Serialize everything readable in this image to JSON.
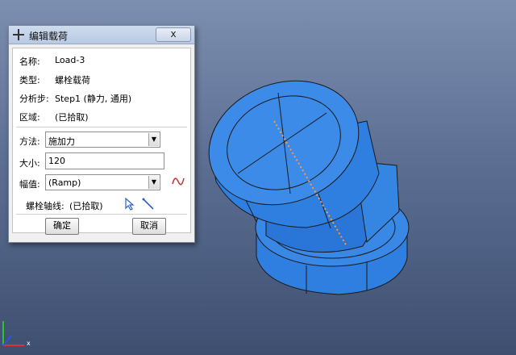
{
  "dialog": {
    "title": "编辑载荷",
    "close_glyph": "x",
    "name_label": "名称:",
    "name_value": "Load-3",
    "type_label": "类型:",
    "type_value": "螺栓载荷",
    "step_label": "分析步:",
    "step_value": "Step1 (静力, 通用)",
    "region_label": "区域:",
    "region_value": "(已拾取)",
    "method_label": "方法:",
    "method_value": "施加力",
    "magnitude_label": "大小:",
    "magnitude_value": "120",
    "amplitude_label": "幅值:",
    "amplitude_value": "(Ramp)",
    "bolt_axis_label": "螺栓轴线:",
    "bolt_axis_value": "(已拾取)",
    "ok_label": "确定",
    "cancel_label": "取消"
  },
  "triad": {
    "x_label": "x"
  },
  "colors": {
    "part_blue": "#2f7fe0",
    "part_blue_dark": "#1f62c0",
    "bolt_axis_dots": "#ff9a3c",
    "amplitude_icon": "#c03030"
  }
}
